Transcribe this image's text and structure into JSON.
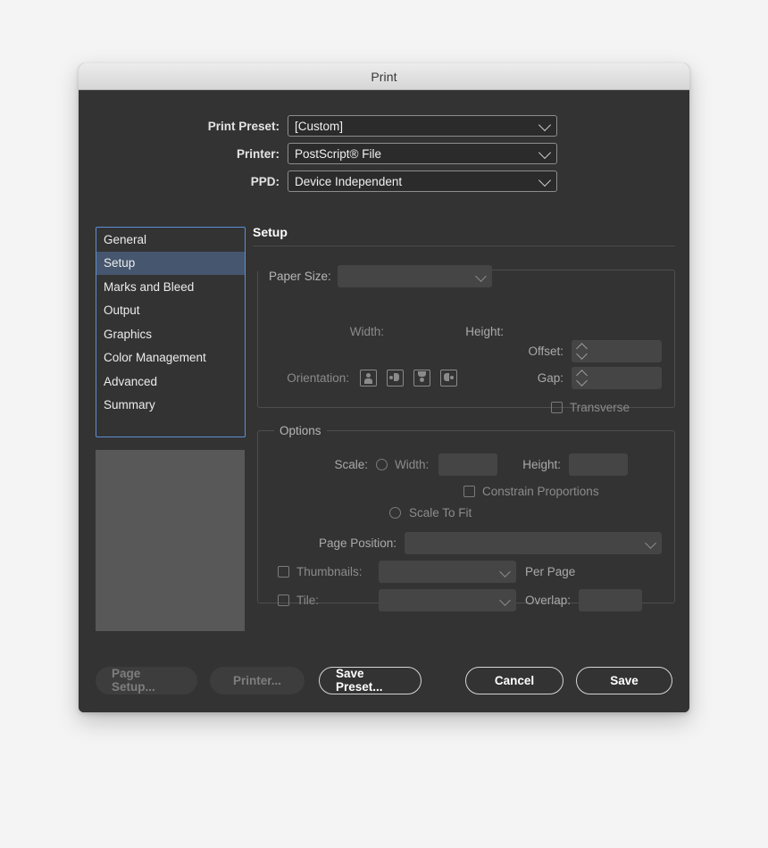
{
  "window": {
    "title": "Print"
  },
  "top_form": {
    "rows": [
      {
        "label": "Print Preset:",
        "value": "[Custom]",
        "name": "print-preset"
      },
      {
        "label": "Printer:",
        "value": "PostScript® File",
        "name": "printer"
      },
      {
        "label": "PPD:",
        "value": "Device Independent",
        "name": "ppd"
      }
    ]
  },
  "sidebar": {
    "selected": "Setup",
    "items": [
      {
        "label": "General"
      },
      {
        "label": "Setup"
      },
      {
        "label": "Marks and Bleed"
      },
      {
        "label": "Output"
      },
      {
        "label": "Graphics"
      },
      {
        "label": "Color Management"
      },
      {
        "label": "Advanced"
      },
      {
        "label": "Summary"
      }
    ]
  },
  "panel": {
    "title": "Setup",
    "paper_group": {
      "paper_size_label": "Paper Size:",
      "paper_size_value": "",
      "width_label": "Width:",
      "width_value": "",
      "height_label": "Height:",
      "height_value": "",
      "orientation_label": "Orientation:",
      "orientation_options": [
        "orientation-portrait",
        "orientation-landscape",
        "orientation-reverse-portrait",
        "orientation-reverse-landscape"
      ],
      "offset_label": "Offset:",
      "offset_value": "",
      "gap_label": "Gap:",
      "gap_value": "",
      "transverse_label": "Transverse",
      "transverse_checked": false
    },
    "options_group": {
      "legend": "Options",
      "scale_label": "Scale:",
      "scale_radio_checked": false,
      "scale_width_label": "Width:",
      "scale_width_value": "",
      "scale_height_label": "Height:",
      "scale_height_value": "",
      "constrain_label": "Constrain Proportions",
      "constrain_checked": false,
      "scale_to_fit_label": "Scale To Fit",
      "scale_to_fit_checked": false,
      "page_position_label": "Page Position:",
      "page_position_value": "",
      "thumbnails_label": "Thumbnails:",
      "thumbnails_checked": false,
      "thumbnails_value": "",
      "per_page_label": "Per Page",
      "tile_label": "Tile:",
      "tile_checked": false,
      "tile_value": "",
      "overlap_label": "Overlap:",
      "overlap_value": ""
    }
  },
  "footer": {
    "page_setup_label": "Page Setup...",
    "printer_label": "Printer...",
    "save_preset_label": "Save Preset...",
    "cancel_label": "Cancel",
    "save_label": "Save"
  },
  "colors": {
    "dialog_bg": "#333333",
    "titlebar": "#e4e4e4",
    "selection_blue": "#46566e",
    "focus_border": "#5c8fd6",
    "preview_gray": "#585858"
  }
}
